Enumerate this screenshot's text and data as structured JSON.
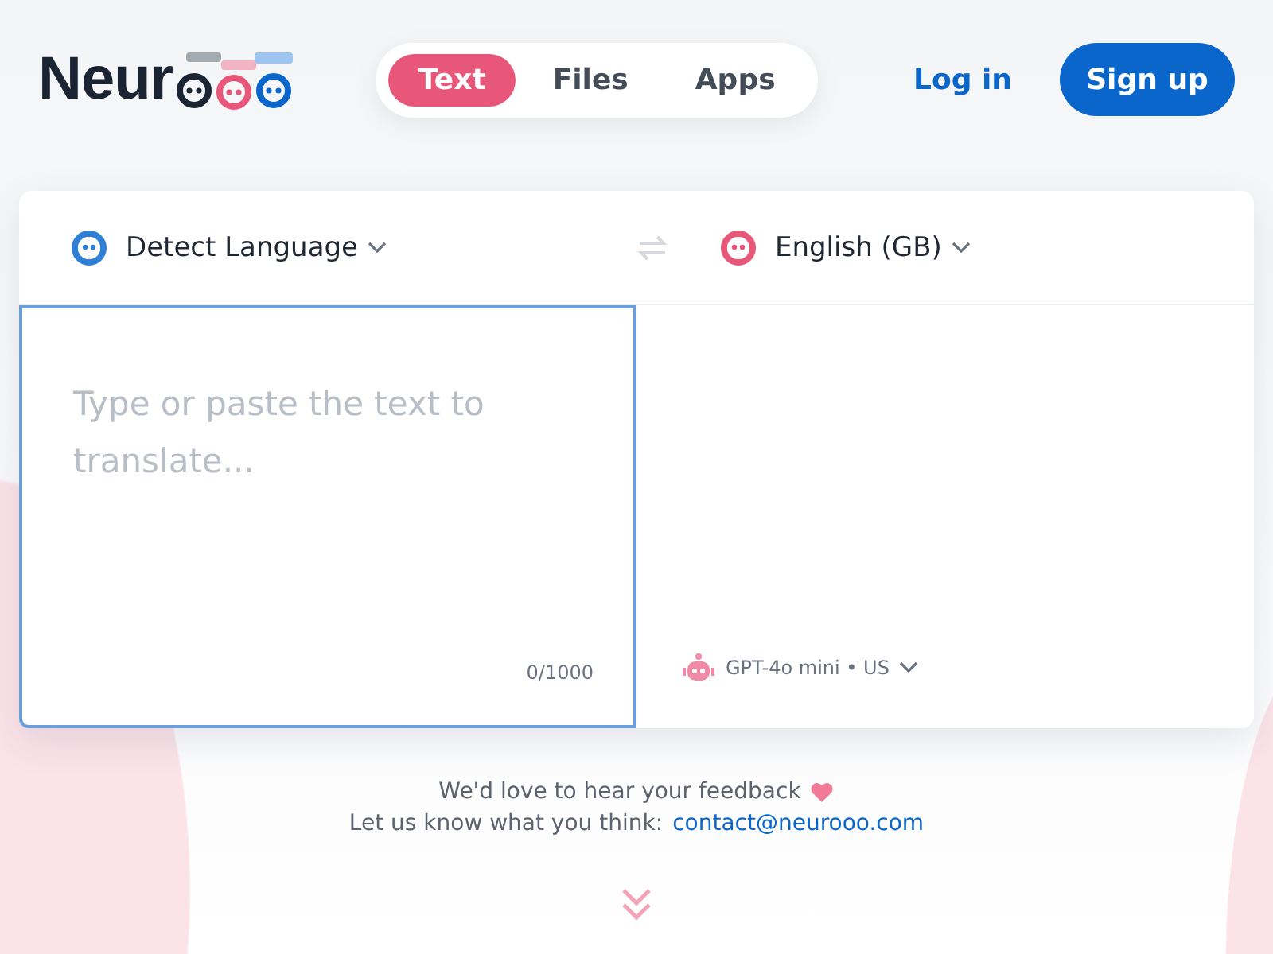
{
  "logo": {
    "text": "Neur"
  },
  "nav": {
    "tabs": [
      {
        "label": "Text",
        "selected": true
      },
      {
        "label": "Files",
        "selected": false
      },
      {
        "label": "Apps",
        "selected": false
      }
    ],
    "login": "Log in",
    "signup": "Sign up"
  },
  "translator": {
    "source_language": "Detect Language",
    "target_language": "English (GB)",
    "input": {
      "placeholder": "Type or paste the text to translate...",
      "counter": "0/1000"
    },
    "model": "GPT-4o mini • US"
  },
  "footer": {
    "feedback": "We'd love to hear your feedback",
    "contact_prefix": "Let us know what you think:",
    "email": "contact@neurooo.com"
  }
}
